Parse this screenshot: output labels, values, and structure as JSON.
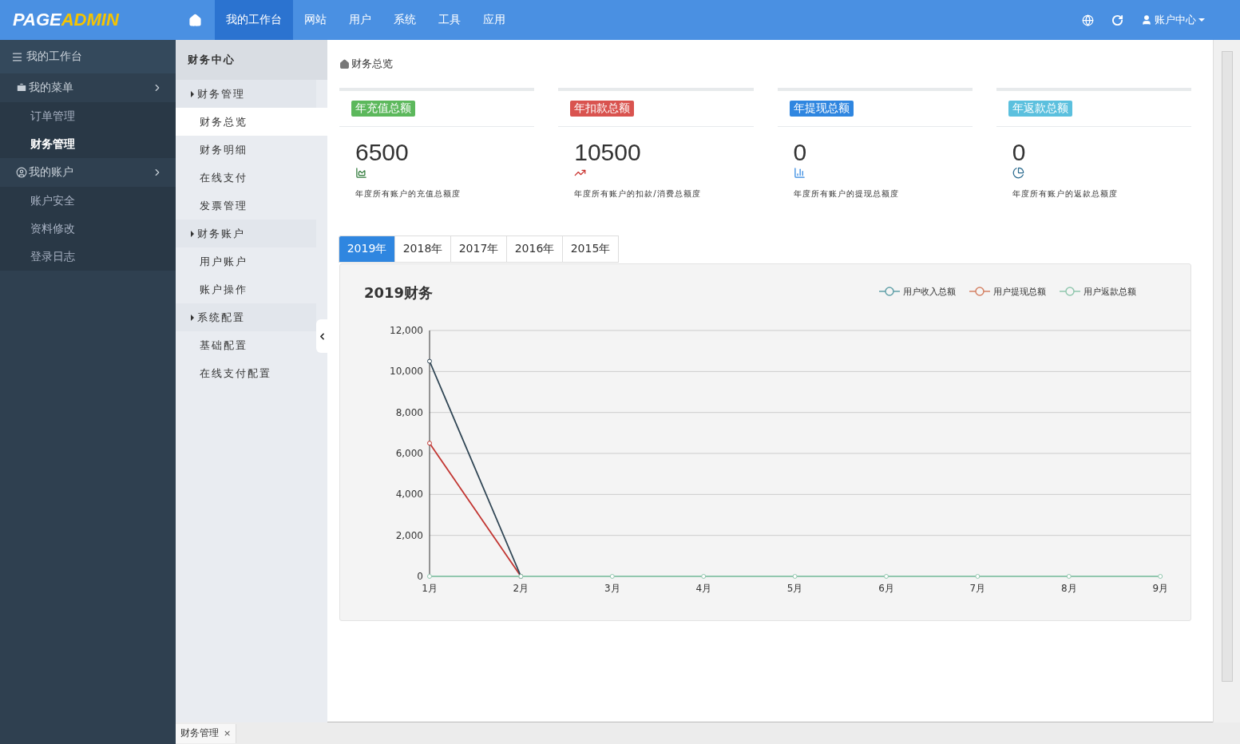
{
  "header": {
    "logo": {
      "first": "PAGE",
      "second": "ADMIN"
    },
    "nav": [
      {
        "label": "我的工作台",
        "selected": true
      },
      {
        "label": "网站",
        "selected": false
      },
      {
        "label": "用户",
        "selected": false
      },
      {
        "label": "系统",
        "selected": false
      },
      {
        "label": "工具",
        "selected": false
      },
      {
        "label": "应用",
        "selected": false
      }
    ],
    "account": "账户中心"
  },
  "sidebar": {
    "title": "我的工作台",
    "groups": [
      {
        "label": "我的菜单",
        "children": [
          {
            "label": "订单管理",
            "selected": false
          },
          {
            "label": "财务管理",
            "selected": true
          }
        ]
      },
      {
        "label": "我的账户",
        "children": [
          {
            "label": "账户安全",
            "selected": false
          },
          {
            "label": "资料修改",
            "selected": false
          },
          {
            "label": "登录日志",
            "selected": false
          }
        ]
      }
    ]
  },
  "subnav": {
    "title": "财务中心",
    "items": [
      {
        "label": "财务管理",
        "kind": "group",
        "selected": false
      },
      {
        "label": "财务总览",
        "kind": "link",
        "selected": true
      },
      {
        "label": "财务明细",
        "kind": "link",
        "selected": false
      },
      {
        "label": "在线支付",
        "kind": "link",
        "selected": false
      },
      {
        "label": "发票管理",
        "kind": "link",
        "selected": false
      },
      {
        "label": "财务账户",
        "kind": "group",
        "selected": false
      },
      {
        "label": "用户账户",
        "kind": "link",
        "selected": false
      },
      {
        "label": "账户操作",
        "kind": "link",
        "selected": false
      },
      {
        "label": "系统配置",
        "kind": "group",
        "selected": false
      },
      {
        "label": "基础配置",
        "kind": "link",
        "selected": false
      },
      {
        "label": "在线支付配置",
        "kind": "link",
        "selected": false
      }
    ]
  },
  "breadcrumb": "财务总览",
  "cards": [
    {
      "badge": "年充值总额",
      "color": "#5cb85c",
      "value": "6500",
      "description": "年度所有账户的充值总额度"
    },
    {
      "badge": "年扣款总额",
      "color": "#d9534f",
      "value": "10500",
      "description": "年度所有账户的扣款/消费总额度"
    },
    {
      "badge": "年提现总额",
      "color": "#2f86e0",
      "value": "0",
      "description": "年度所有账户的提现总额度"
    },
    {
      "badge": "年返款总额",
      "color": "#5bc0de",
      "value": "0",
      "description": "年度所有账户的返款总额度"
    }
  ],
  "year_tabs": [
    {
      "label": "2019年",
      "selected": true
    },
    {
      "label": "2018年",
      "selected": false
    },
    {
      "label": "2017年",
      "selected": false
    },
    {
      "label": "2016年",
      "selected": false
    },
    {
      "label": "2015年",
      "selected": false
    }
  ],
  "chart_panel": {
    "title": "2019财务",
    "chart_data": {
      "type": "line",
      "categories": [
        "1月",
        "2月",
        "3月",
        "4月",
        "5月",
        "6月",
        "7月",
        "8月",
        "9月"
      ],
      "series": [
        {
          "color": "#c23531",
          "marker": "circle",
          "values": [
            6500,
            0,
            null,
            null,
            null,
            null,
            null,
            null,
            null
          ]
        },
        {
          "color": "#2f4554",
          "marker": "circle",
          "values": [
            10500,
            0,
            null,
            null,
            null,
            null,
            null,
            null,
            null
          ]
        },
        {
          "name": "用户收入总额",
          "color": "#61a0a8",
          "marker": "circle",
          "values": [
            null,
            null,
            null,
            null,
            null,
            null,
            null,
            null,
            null
          ]
        },
        {
          "name": "用户提现总额",
          "color": "#d48265",
          "marker": "circle",
          "values": [
            null,
            null,
            null,
            null,
            null,
            null,
            null,
            null,
            null
          ]
        },
        {
          "name": "用户返款总额",
          "color": "#91c7ae",
          "marker": "circle",
          "values": [
            0,
            0,
            0,
            0,
            0,
            0,
            0,
            0,
            0
          ]
        }
      ],
      "grid": true,
      "legend": "top-right",
      "ylim": [
        0,
        12000
      ],
      "yticks": [
        {
          "value": 0,
          "label": "0"
        },
        {
          "value": 2000,
          "label": "2,000"
        },
        {
          "value": 4000,
          "label": "4,000"
        },
        {
          "value": 6000,
          "label": "6,000"
        },
        {
          "value": 8000,
          "label": "8,000"
        },
        {
          "value": 10000,
          "label": "10,000"
        },
        {
          "value": 12000,
          "label": "12,000"
        }
      ]
    }
  },
  "bottom_tabs": [
    {
      "label": "财务管理",
      "close": "×"
    }
  ]
}
